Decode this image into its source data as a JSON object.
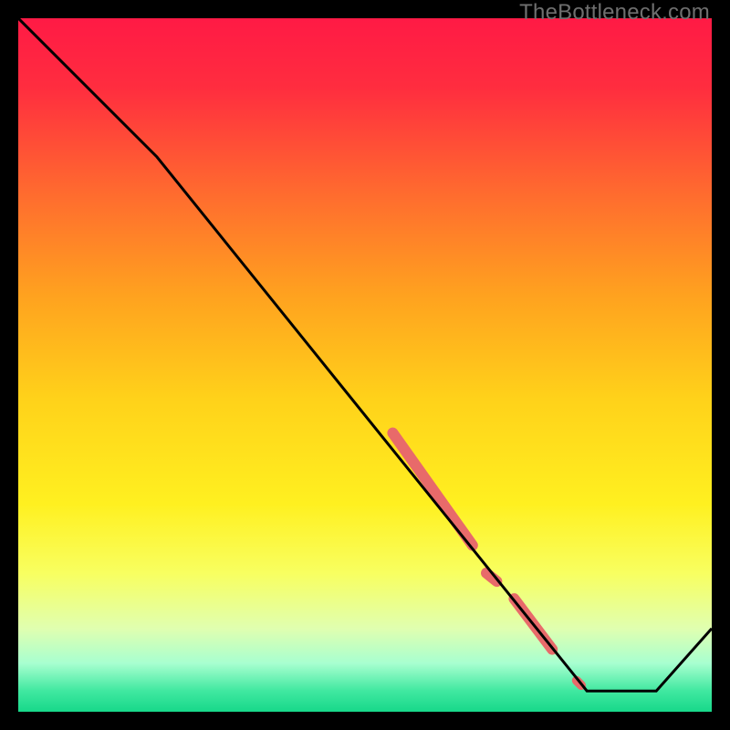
{
  "watermark": "TheBottleneck.com",
  "chart_data": {
    "type": "line",
    "title": "",
    "xlabel": "",
    "ylabel": "",
    "xlim": [
      0,
      100
    ],
    "ylim": [
      0,
      100
    ],
    "x": [
      0,
      20,
      82,
      92,
      100
    ],
    "values": [
      100,
      80,
      3,
      3,
      12
    ],
    "highlight_segments": [
      {
        "x0": 54,
        "y0": 40.2,
        "x1": 65.5,
        "y1": 24.0,
        "width": 12
      },
      {
        "x0": 67.5,
        "y0": 20.0,
        "x1": 69.0,
        "y1": 18.8,
        "width": 12
      },
      {
        "x0": 71.5,
        "y0": 16.3,
        "x1": 77.0,
        "y1": 9.0,
        "width": 12
      },
      {
        "x0": 80.5,
        "y0": 4.5,
        "x1": 81.2,
        "y1": 3.8,
        "width": 10
      }
    ],
    "gradient_stops": [
      {
        "offset": 0.0,
        "color": "#ff1a45"
      },
      {
        "offset": 0.1,
        "color": "#ff2d3f"
      },
      {
        "offset": 0.25,
        "color": "#ff6a2f"
      },
      {
        "offset": 0.4,
        "color": "#ffa21f"
      },
      {
        "offset": 0.55,
        "color": "#ffd21a"
      },
      {
        "offset": 0.7,
        "color": "#fff020"
      },
      {
        "offset": 0.8,
        "color": "#f8ff60"
      },
      {
        "offset": 0.88,
        "color": "#e0ffb0"
      },
      {
        "offset": 0.93,
        "color": "#a8ffd0"
      },
      {
        "offset": 0.97,
        "color": "#40e8a0"
      },
      {
        "offset": 1.0,
        "color": "#17d88a"
      }
    ],
    "highlight_color": "#e86a6a",
    "line_color": "#000000"
  }
}
